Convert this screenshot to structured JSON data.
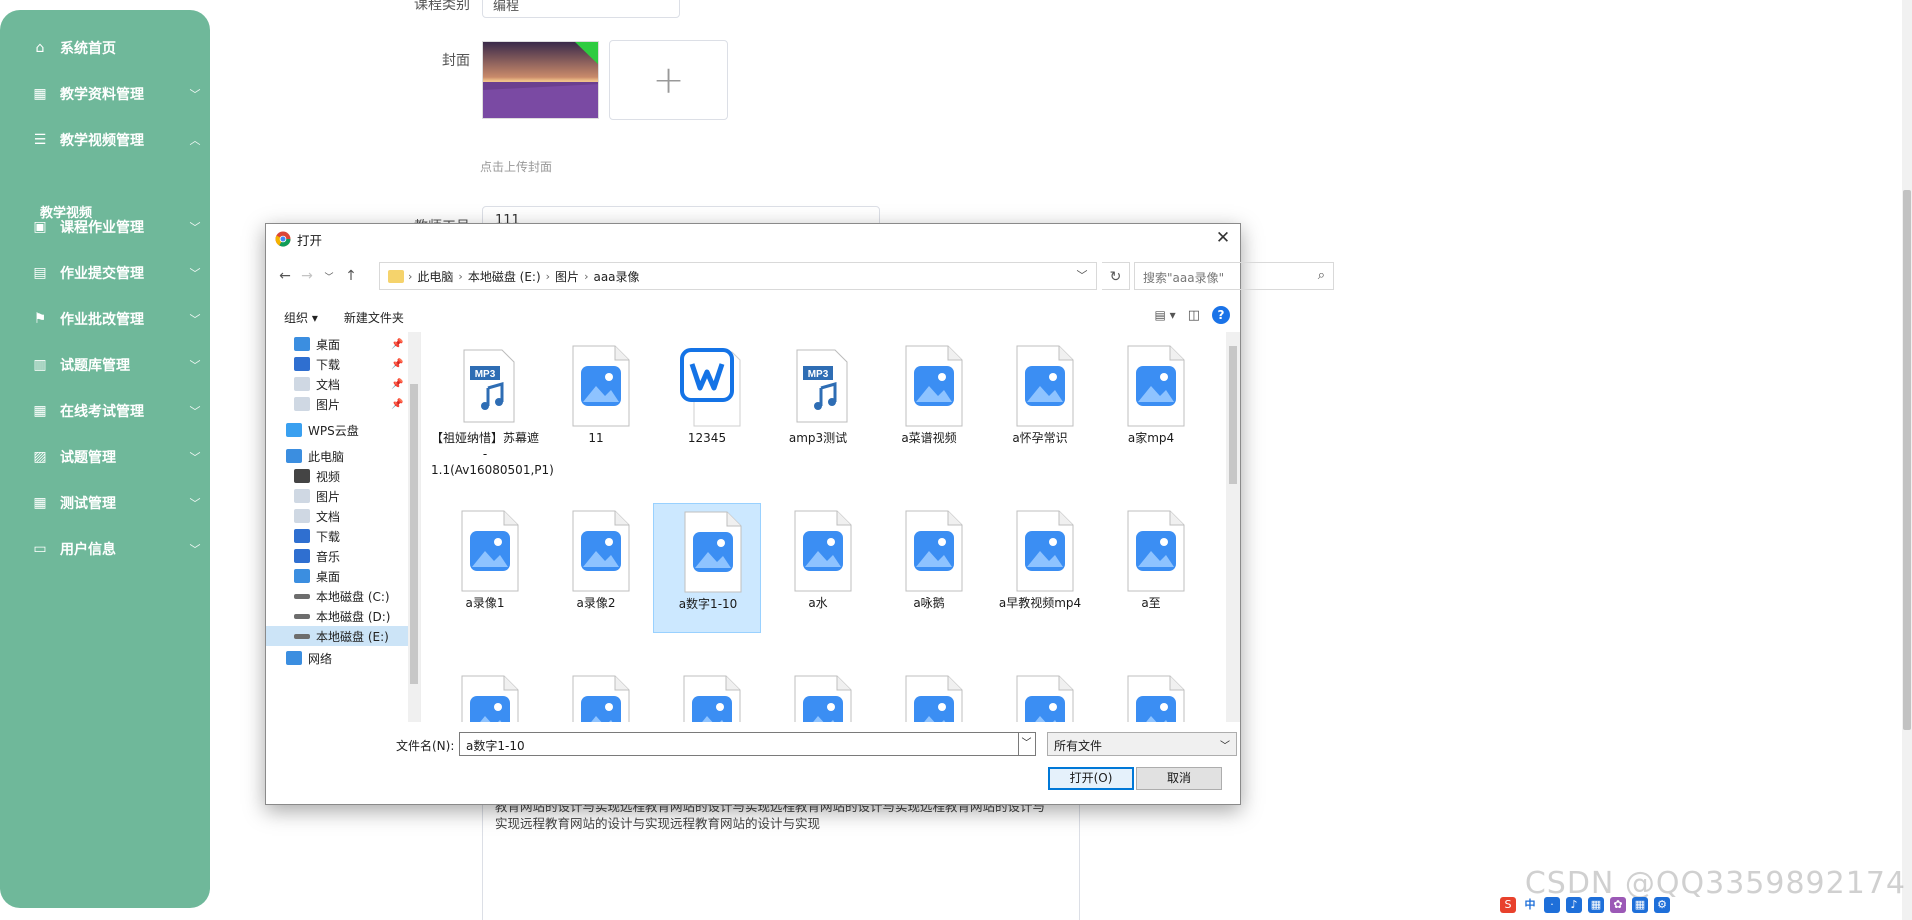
{
  "sidebar": {
    "items": [
      {
        "label": "系统首页",
        "icon": "home-icon",
        "expand": ""
      },
      {
        "label": "教学资料管理",
        "icon": "grid-icon",
        "expand": "﹀"
      },
      {
        "label": "教学视频管理",
        "icon": "sliders-icon",
        "expand": "︿"
      },
      {
        "label": "课程作业管理",
        "icon": "clipboard-icon",
        "expand": "﹀"
      },
      {
        "label": "作业提交管理",
        "icon": "briefcase-icon",
        "expand": "﹀"
      },
      {
        "label": "作业批改管理",
        "icon": "flag-icon",
        "expand": "﹀"
      },
      {
        "label": "试题库管理",
        "icon": "chart-icon",
        "expand": "﹀"
      },
      {
        "label": "在线考试管理",
        "icon": "grid-icon",
        "expand": "﹀"
      },
      {
        "label": "试题管理",
        "icon": "chart-line-icon",
        "expand": "﹀"
      },
      {
        "label": "测试管理",
        "icon": "grid-icon",
        "expand": "﹀"
      },
      {
        "label": "用户信息",
        "icon": "card-icon",
        "expand": "﹀"
      }
    ],
    "sub_item": "教学视频"
  },
  "form": {
    "category_label": "课程类别",
    "category_value": "编程",
    "cover_label": "封面",
    "upload_hint": "点击上传封面",
    "teacher_label": "教师工号",
    "teacher_value": "111",
    "description_text": "教育网站的设计与实现远程教育网站的设计与实现远程教育网站的设计与实现远程教育网站的设计与实现远程教育网站的设计与实现远程教育网站的设计与实现"
  },
  "watermark": "CSDN @QQ3359892174",
  "dialog": {
    "title": "打开",
    "breadcrumbs": [
      "此电脑",
      "本地磁盘 (E:)",
      "图片",
      "aaa录像"
    ],
    "search_placeholder": "搜索\"aaa录像\"",
    "organize": "组织 ▾",
    "new_folder": "新建文件夹",
    "nav_items": [
      {
        "label": "桌面",
        "icon": "desktop-icon",
        "pinned": true
      },
      {
        "label": "下载",
        "icon": "download-icon",
        "pinned": true
      },
      {
        "label": "文档",
        "icon": "document-icon",
        "pinned": true
      },
      {
        "label": "图片",
        "icon": "pictures-icon",
        "pinned": true
      },
      {
        "label": "WPS云盘",
        "icon": "cloud-icon",
        "pinned": false
      },
      {
        "label": "此电脑",
        "icon": "computer-icon",
        "pinned": false
      },
      {
        "label": "视频",
        "icon": "video-icon",
        "pinned": false
      },
      {
        "label": "图片",
        "icon": "pictures-icon",
        "pinned": false
      },
      {
        "label": "文档",
        "icon": "document-icon",
        "pinned": false
      },
      {
        "label": "下载",
        "icon": "download-icon",
        "pinned": false
      },
      {
        "label": "音乐",
        "icon": "music-icon",
        "pinned": false
      },
      {
        "label": "桌面",
        "icon": "desktop-icon",
        "pinned": false
      },
      {
        "label": "本地磁盘 (C:)",
        "icon": "drive-icon",
        "pinned": false
      },
      {
        "label": "本地磁盘 (D:)",
        "icon": "drive-icon",
        "pinned": false
      },
      {
        "label": "本地磁盘 (E:)",
        "icon": "drive-icon",
        "pinned": false,
        "selected": true
      },
      {
        "label": "网络",
        "icon": "network-icon",
        "pinned": false
      }
    ],
    "files": [
      {
        "name": "【祖娅纳惜】苏幕遮 - 1.1(Av16080501,P1)",
        "type": "mp3"
      },
      {
        "name": "11",
        "type": "image"
      },
      {
        "name": "12345",
        "type": "wps"
      },
      {
        "name": "amp3测试",
        "type": "mp3"
      },
      {
        "name": "a菜谱视频",
        "type": "image"
      },
      {
        "name": "a怀孕常识",
        "type": "image"
      },
      {
        "name": "a家mp4",
        "type": "image"
      },
      {
        "name": "a录像1",
        "type": "image"
      },
      {
        "name": "a录像2",
        "type": "image"
      },
      {
        "name": "a数字1-10",
        "type": "image",
        "selected": true
      },
      {
        "name": "a水",
        "type": "image"
      },
      {
        "name": "a咏鹅",
        "type": "image"
      },
      {
        "name": "a早教视频mp4",
        "type": "image"
      },
      {
        "name": "a至",
        "type": "image"
      },
      {
        "name": "",
        "type": "image"
      },
      {
        "name": "",
        "type": "image"
      },
      {
        "name": "",
        "type": "image"
      },
      {
        "name": "",
        "type": "image"
      },
      {
        "name": "",
        "type": "image"
      },
      {
        "name": "",
        "type": "image"
      },
      {
        "name": "",
        "type": "image"
      }
    ],
    "filename_label": "文件名(N):",
    "filename_value": "a数字1-10",
    "filetype_value": "所有文件",
    "open_label": "打开(O)",
    "cancel_label": "取消"
  },
  "tray": {
    "ime": "中"
  },
  "colors": {
    "sidebar": "#6fb89a",
    "accent": "#0078d7",
    "selection": "#cce8ff"
  }
}
